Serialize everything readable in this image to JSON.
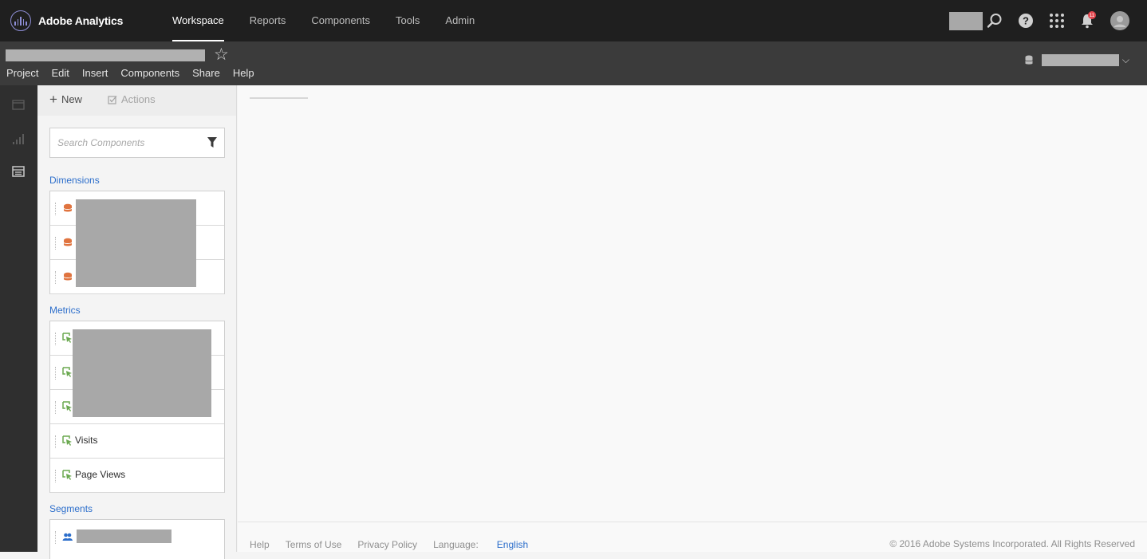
{
  "app": {
    "name": "Adobe Analytics"
  },
  "nav": {
    "items": [
      {
        "label": "Workspace",
        "active": true
      },
      {
        "label": "Reports",
        "active": false
      },
      {
        "label": "Components",
        "active": false
      },
      {
        "label": "Tools",
        "active": false
      },
      {
        "label": "Admin",
        "active": false
      }
    ]
  },
  "top_right": {
    "notification_count": "11",
    "icons": [
      "search-icon",
      "help-icon",
      "apps-grid-icon",
      "bell-icon",
      "avatar"
    ]
  },
  "menubar": {
    "items": [
      "Project",
      "Edit",
      "Insert",
      "Components",
      "Share",
      "Help"
    ]
  },
  "panel": {
    "toolbar": {
      "new_label": "New",
      "actions_label": "Actions"
    },
    "search": {
      "placeholder": "Search Components"
    },
    "dimensions": {
      "label": "Dimensions",
      "icon": "dimension-icon"
    },
    "metrics": {
      "label": "Metrics",
      "icon": "metric-icon",
      "visible_items": [
        "Visits",
        "Page Views"
      ]
    },
    "segments": {
      "label": "Segments",
      "icon": "segment-icon"
    }
  },
  "footer": {
    "links": [
      "Help",
      "Terms of Use",
      "Privacy Policy"
    ],
    "language_label": "Language:",
    "language_value": "English",
    "copyright": "© 2016 Adobe Systems Incorporated. All Rights Reserved"
  },
  "colors": {
    "topbar": "#1f1f1f",
    "projbar": "#3b3b3b",
    "accent_link": "#2c6ecb",
    "dimension_icon": "#e0743f",
    "metric_icon": "#6aa84f",
    "notification_badge": "#e34850"
  }
}
